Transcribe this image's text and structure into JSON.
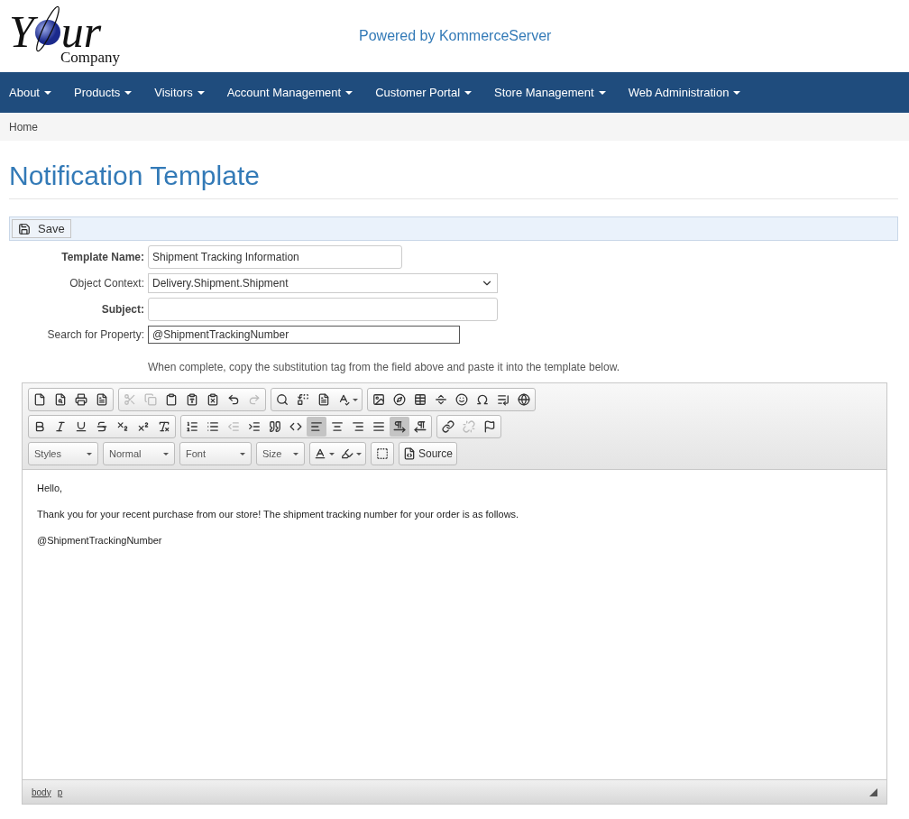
{
  "logo": {
    "text_1": "Y",
    "text_2": "ur",
    "subtitle": "Company"
  },
  "tagline": "Powered by KommerceServer",
  "nav": [
    {
      "label": "About"
    },
    {
      "label": "Products"
    },
    {
      "label": "Visitors"
    },
    {
      "label": "Account Management"
    },
    {
      "label": "Customer Portal"
    },
    {
      "label": "Store Management"
    },
    {
      "label": "Web Administration"
    }
  ],
  "breadcrumb": "Home",
  "title": "Notification Template",
  "save_button": "Save",
  "form": [
    {
      "label": "Template Name:",
      "bold": true,
      "kind": "text",
      "value": "Shipment Tracking Information"
    },
    {
      "label": "Object Context:",
      "bold": false,
      "kind": "select",
      "value": "Delivery.Shipment.Shipment"
    },
    {
      "label": "Subject:",
      "bold": true,
      "kind": "text"
    },
    {
      "label": "Search for Property:",
      "bold": false,
      "kind": "search",
      "value": "@ShipmentTrackingNumber"
    }
  ],
  "hint": "When complete, copy the substitution tag from the field above and paste it into the template below.",
  "editor": {
    "toolbar_rows": [
      [
        {
          "buttons": [
            {
              "kind": "new-page",
              "disabled": false,
              "on": false
            },
            {
              "kind": "preview",
              "disabled": false,
              "on": false
            },
            {
              "kind": "print",
              "disabled": false,
              "on": false
            },
            {
              "kind": "templates",
              "disabled": false,
              "on": false
            }
          ]
        },
        {
          "buttons": [
            {
              "kind": "cut",
              "disabled": true,
              "on": false
            },
            {
              "kind": "copy",
              "disabled": true,
              "on": false
            },
            {
              "kind": "paste",
              "disabled": false,
              "on": false
            },
            {
              "kind": "paste-text",
              "disabled": false,
              "on": false
            },
            {
              "kind": "paste-word",
              "disabled": false,
              "on": false
            },
            {
              "kind": "undo",
              "disabled": false,
              "on": false
            },
            {
              "kind": "redo",
              "disabled": true,
              "on": false
            }
          ]
        },
        {
          "buttons": [
            {
              "kind": "find",
              "disabled": false,
              "on": false
            },
            {
              "kind": "replace",
              "disabled": false,
              "on": false
            },
            {
              "kind": "select-all",
              "disabled": false,
              "on": false
            },
            {
              "kind": "spellcheck",
              "disabled": false,
              "on": false
            }
          ]
        },
        {
          "buttons": [
            {
              "kind": "image",
              "disabled": false,
              "on": false
            },
            {
              "kind": "flash",
              "disabled": false,
              "on": false
            },
            {
              "kind": "table",
              "disabled": false,
              "on": false
            },
            {
              "kind": "horizontal-line",
              "disabled": false,
              "on": false
            },
            {
              "kind": "smiley",
              "disabled": false,
              "on": false
            },
            {
              "kind": "special-char",
              "disabled": false,
              "on": false
            },
            {
              "kind": "page-break",
              "disabled": false,
              "on": false
            },
            {
              "kind": "iframe",
              "disabled": false,
              "on": false
            }
          ]
        }
      ],
      [
        {
          "buttons": [
            {
              "kind": "bold",
              "disabled": false,
              "on": false
            },
            {
              "kind": "italic",
              "disabled": false,
              "on": false
            },
            {
              "kind": "underline",
              "disabled": false,
              "on": false
            },
            {
              "kind": "strike",
              "disabled": false,
              "on": false
            },
            {
              "kind": "subscript",
              "disabled": false,
              "on": false
            },
            {
              "kind": "superscript",
              "disabled": false,
              "on": false
            },
            {
              "kind": "remove-format",
              "disabled": false,
              "on": false
            }
          ]
        },
        {
          "buttons": [
            {
              "kind": "numbered-list",
              "disabled": false,
              "on": false
            },
            {
              "kind": "bulleted-list",
              "disabled": false,
              "on": false
            },
            {
              "kind": "outdent",
              "disabled": true,
              "on": false
            },
            {
              "kind": "indent",
              "disabled": false,
              "on": false
            },
            {
              "kind": "blockquote",
              "disabled": false,
              "on": false
            },
            {
              "kind": "create-div",
              "disabled": false,
              "on": false
            },
            {
              "kind": "align-left",
              "disabled": false,
              "on": true
            },
            {
              "kind": "align-center",
              "disabled": false,
              "on": false
            },
            {
              "kind": "align-right",
              "disabled": false,
              "on": false
            },
            {
              "kind": "justify",
              "disabled": false,
              "on": false
            },
            {
              "kind": "left-to-right",
              "disabled": false,
              "on": true
            },
            {
              "kind": "right-to-left",
              "disabled": false,
              "on": false
            }
          ]
        },
        {
          "buttons": [
            {
              "kind": "link",
              "disabled": false,
              "on": false
            },
            {
              "kind": "unlink",
              "disabled": true,
              "on": false
            },
            {
              "kind": "anchor",
              "disabled": false,
              "on": false
            }
          ]
        }
      ],
      [
        {
          "buttons": [
            {
              "kind": "combo",
              "label": "Styles",
              "disabled": false,
              "on": false
            }
          ]
        },
        {
          "buttons": [
            {
              "kind": "combo",
              "label": "Normal",
              "disabled": false,
              "on": false
            }
          ]
        },
        {
          "buttons": [
            {
              "kind": "combo",
              "label": "Font",
              "disabled": false,
              "on": false
            }
          ]
        },
        {
          "buttons": [
            {
              "kind": "combo",
              "label": "Size",
              "disabled": false,
              "on": false
            }
          ]
        },
        {
          "buttons": [
            {
              "kind": "text-color",
              "disabled": false,
              "on": false
            },
            {
              "kind": "background-color",
              "disabled": false,
              "on": false
            }
          ]
        },
        {
          "buttons": [
            {
              "kind": "show-blocks",
              "disabled": false,
              "on": false
            }
          ]
        },
        {
          "buttons": [
            {
              "kind": "source",
              "label": "Source",
              "disabled": false,
              "on": false
            }
          ]
        }
      ]
    ],
    "content": [
      "Hello,",
      "Thank you for your recent purchase from our store! The shipment tracking number for your order is as follows.",
      "@ShipmentTrackingNumber"
    ],
    "path": [
      "body",
      "p"
    ]
  }
}
